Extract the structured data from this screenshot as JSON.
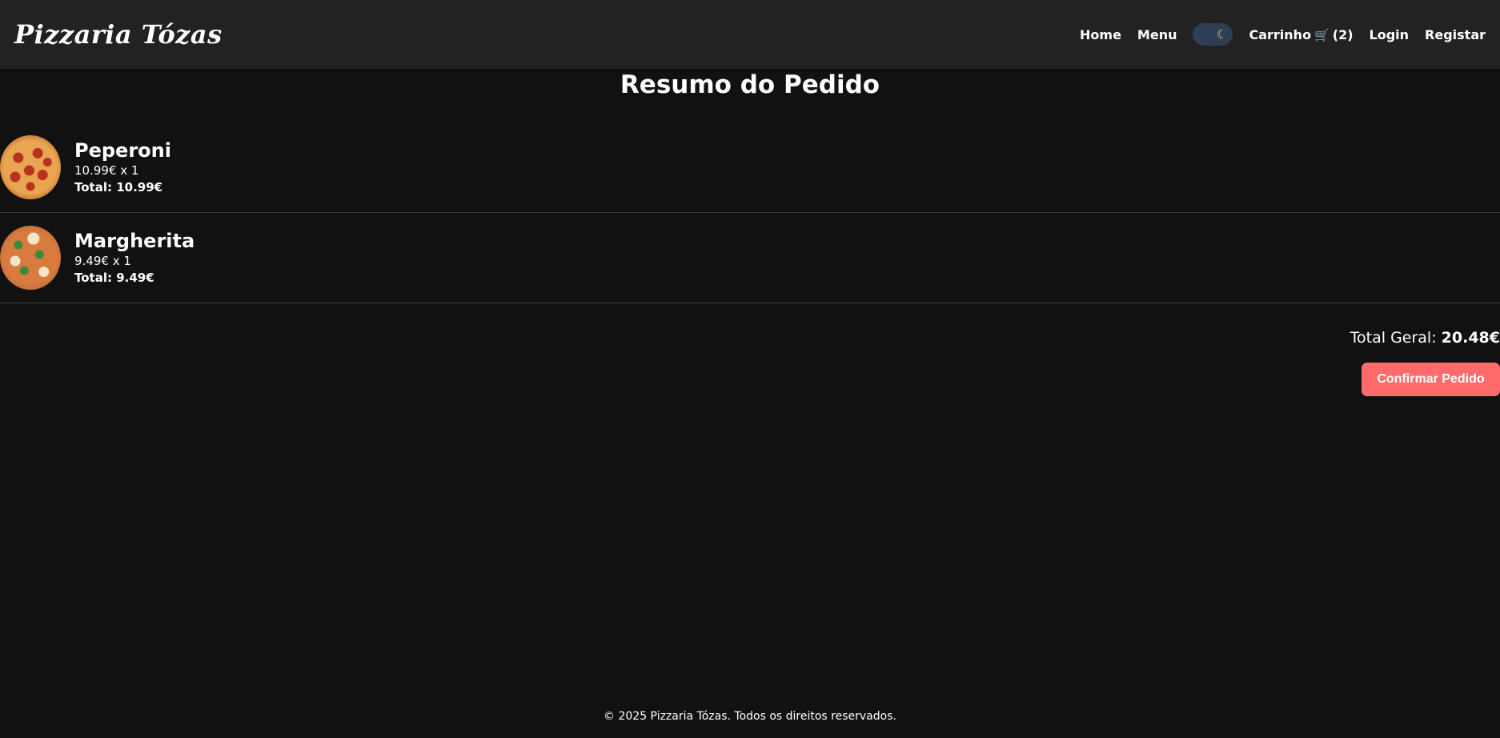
{
  "navbar": {
    "brand": "Pizzaria Tózas",
    "links": {
      "home": "Home",
      "menu": "Menu",
      "login": "Login",
      "register": "Registar"
    },
    "theme_toggle_icon": "moon-icon",
    "cart": {
      "label": "Carrinho",
      "icon": "cart-icon",
      "count": "(2)"
    }
  },
  "page": {
    "title": "Resumo do Pedido"
  },
  "order": {
    "items": [
      {
        "name": "Peperoni",
        "qty_line": "10.99€ x 1",
        "total_line": "Total: 10.99€",
        "image": "pepperoni-pizza"
      },
      {
        "name": "Margherita",
        "qty_line": "9.49€ x 1",
        "total_line": "Total: 9.49€",
        "image": "margherita-pizza"
      }
    ],
    "grand_total_label": "Total Geral:",
    "grand_total_value": "20.48€",
    "confirm_label": "Confirmar Pedido"
  },
  "footer": {
    "text": "© 2025 Pizzaria Tózas. Todos os direitos reservados."
  },
  "colors": {
    "background": "#111111",
    "navbar": "#222222",
    "accent": "#ff6b6b",
    "toggle": "#2e3f55"
  }
}
